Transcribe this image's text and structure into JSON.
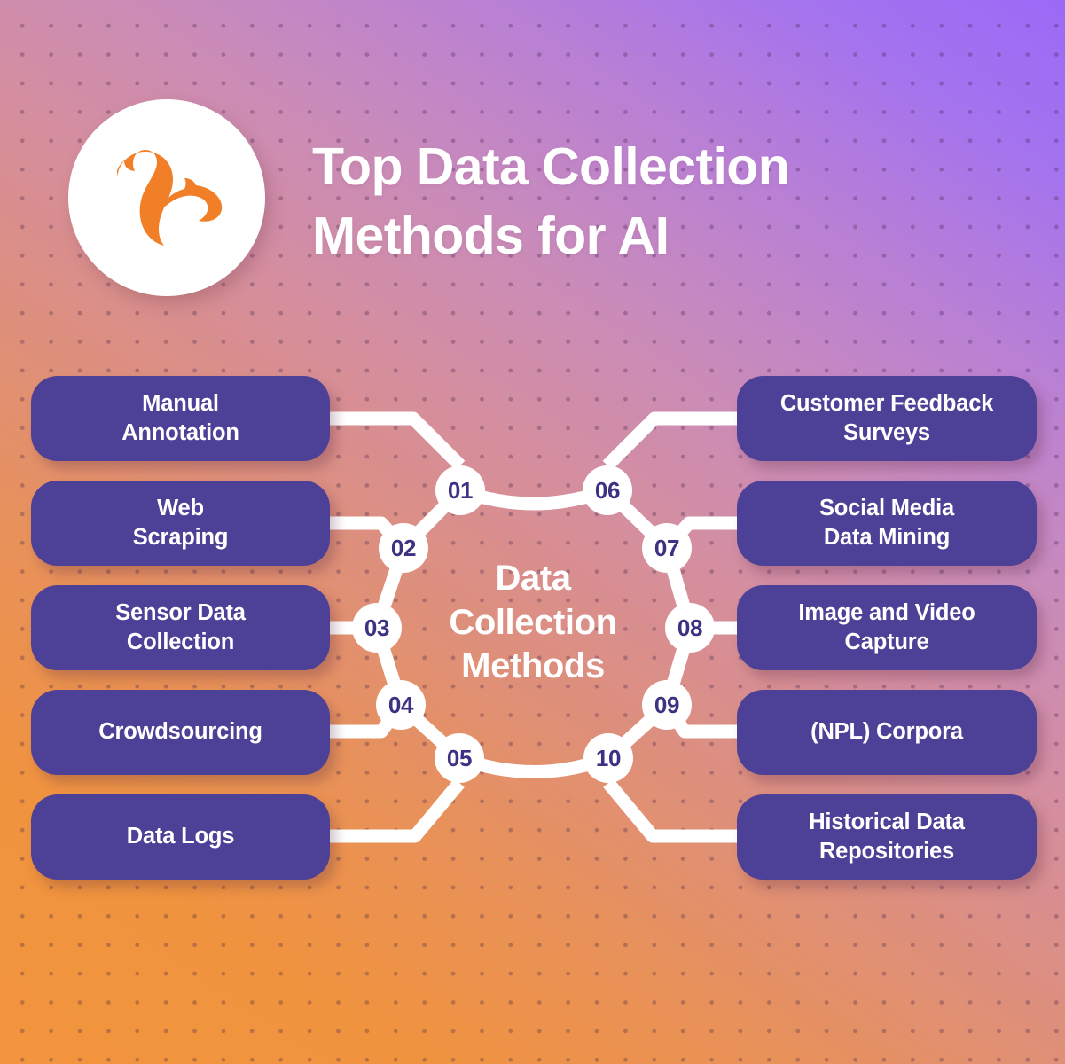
{
  "header": {
    "title_line1": "Top Data Collection",
    "title_line2": "Methods for AI",
    "logo_name": "squirrel-logo",
    "logo_color": "#f07f28"
  },
  "theme": {
    "card_bg": "#4c4196",
    "card_text": "#ffffff",
    "node_bg": "#ffffff",
    "node_text": "#3b3283",
    "connector": "#ffffff",
    "gradient_start": "#f2953e",
    "gradient_end": "#9a6af7"
  },
  "center": {
    "line1": "Data",
    "line2": "Collection",
    "line3": "Methods"
  },
  "left_items": [
    {
      "number": "01",
      "label_line1": "Manual",
      "label_line2": "Annotation"
    },
    {
      "number": "02",
      "label_line1": "Web",
      "label_line2": "Scraping"
    },
    {
      "number": "03",
      "label_line1": "Sensor Data",
      "label_line2": "Collection"
    },
    {
      "number": "04",
      "label_line1": "Crowdsourcing",
      "label_line2": ""
    },
    {
      "number": "05",
      "label_line1": "Data Logs",
      "label_line2": ""
    }
  ],
  "right_items": [
    {
      "number": "06",
      "label_line1": "Customer Feedback",
      "label_line2": "Surveys"
    },
    {
      "number": "07",
      "label_line1": "Social Media",
      "label_line2": "Data Mining"
    },
    {
      "number": "08",
      "label_line1": "Image and Video",
      "label_line2": "Capture"
    },
    {
      "number": "09",
      "label_line1": "(NPL) Corpora",
      "label_line2": ""
    },
    {
      "number": "10",
      "label_line1": "Historical Data",
      "label_line2": "Repositories"
    }
  ]
}
